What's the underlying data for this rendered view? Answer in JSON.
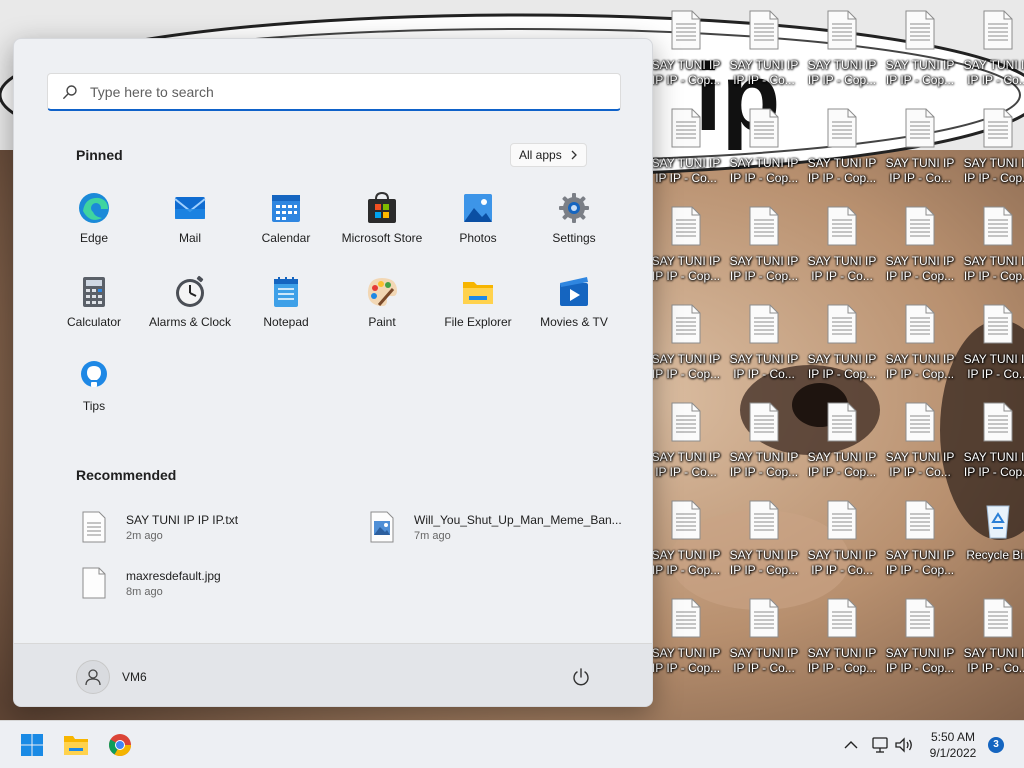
{
  "colors": {
    "accent": "#0f62c9",
    "start_menu_bg": "#eef0f3",
    "taskbar_bg": "#edeff3",
    "badge_bg": "#1565c0"
  },
  "desktop": {
    "wallpaper_text": "ip",
    "icons": [
      {
        "label": "SAY TUNI IP\nIP IP - Cop...",
        "icon": "text-document-icon"
      },
      {
        "label": "SAY TUNI IP\nIP IP - Co...",
        "icon": "text-document-icon"
      },
      {
        "label": "SAY TUNI IP\nIP IP - Cop...",
        "icon": "text-document-icon"
      },
      {
        "label": "Recycle Bin",
        "icon": "recycle-bin-icon"
      }
    ]
  },
  "start_menu": {
    "search": {
      "placeholder": "Type here to search",
      "icon": "search-icon"
    },
    "pinned": {
      "title": "Pinned",
      "all_apps_label": "All apps",
      "apps": [
        {
          "label": "Edge",
          "icon": "edge-icon"
        },
        {
          "label": "Mail",
          "icon": "mail-icon"
        },
        {
          "label": "Calendar",
          "icon": "calendar-icon"
        },
        {
          "label": "Microsoft Store",
          "icon": "store-icon"
        },
        {
          "label": "Photos",
          "icon": "photos-icon"
        },
        {
          "label": "Settings",
          "icon": "settings-gear-icon"
        },
        {
          "label": "Calculator",
          "icon": "calculator-icon"
        },
        {
          "label": "Alarms & Clock",
          "icon": "alarm-clock-icon"
        },
        {
          "label": "Notepad",
          "icon": "notepad-icon"
        },
        {
          "label": "Paint",
          "icon": "paint-palette-icon"
        },
        {
          "label": "File Explorer",
          "icon": "folder-icon"
        },
        {
          "label": "Movies & TV",
          "icon": "movies-tv-icon"
        },
        {
          "label": "Tips",
          "icon": "tips-lightbulb-icon"
        }
      ]
    },
    "recommended": {
      "title": "Recommended",
      "items": [
        {
          "name": "SAY TUNI IP IP IP.txt",
          "time": "2m ago",
          "icon": "text-file-icon"
        },
        {
          "name": "Will_You_Shut_Up_Man_Meme_Ban...",
          "time": "7m ago",
          "icon": "image-file-icon"
        },
        {
          "name": "maxresdefault.jpg",
          "time": "8m ago",
          "icon": "blank-file-icon"
        }
      ]
    },
    "footer": {
      "user_name": "VM6",
      "user_icon": "user-avatar-icon",
      "power_icon": "power-icon"
    }
  },
  "taskbar": {
    "pinned": [
      {
        "icon": "windows-start-icon"
      },
      {
        "icon": "file-explorer-icon"
      },
      {
        "icon": "chrome-icon"
      }
    ],
    "tray": {
      "time": "5:50 AM",
      "date": "9/1/2022",
      "notification_count": "3"
    }
  }
}
